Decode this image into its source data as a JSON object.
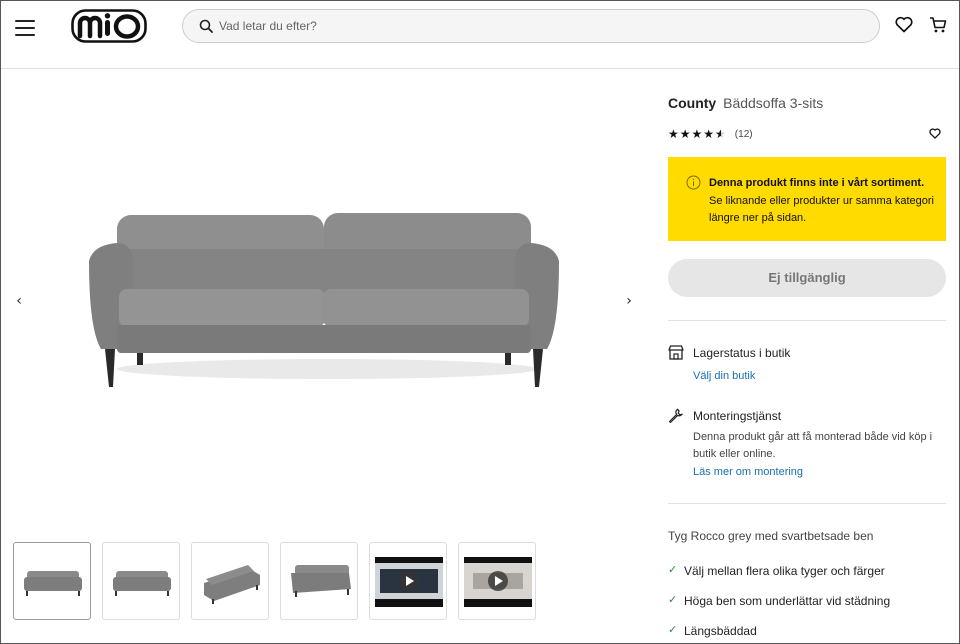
{
  "header": {
    "logo_text": "mio",
    "search_placeholder": "Vad letar du efter?"
  },
  "product": {
    "brand": "County",
    "model": "Bäddsoffa 3-sits",
    "rating_stars": 4.5,
    "review_count": "(12)"
  },
  "notice": {
    "title": "Denna produkt finns inte i vårt sortiment.",
    "body": "Se liknande eller produkter ur samma kategori längre ner på sidan."
  },
  "unavailable_label": "Ej tillgänglig",
  "store_status": {
    "title": "Lagerstatus i butik",
    "link": "Välj din butik"
  },
  "assembly": {
    "title": "Monteringstjänst",
    "body": "Denna produkt går att få monterad både vid köp i butik eller online.",
    "link": "Läs mer om montering"
  },
  "fabric": "Tyg Rocco grey med svartbetsade ben",
  "features": [
    "Välj mellan flera olika tyger och färger",
    "Höga ben som underlättar vid städning",
    "Längsbäddad"
  ],
  "thumbnails": [
    {
      "kind": "image",
      "view": "front"
    },
    {
      "kind": "image",
      "view": "front"
    },
    {
      "kind": "image",
      "view": "angle"
    },
    {
      "kind": "image",
      "view": "side-angle"
    },
    {
      "kind": "video",
      "view": "bed"
    },
    {
      "kind": "video",
      "view": "room"
    }
  ],
  "colors": {
    "notice_bg": "#ffdb00",
    "link": "#1a6fb0",
    "check": "#2e8b3d",
    "sofa": "#8a8a8a"
  }
}
